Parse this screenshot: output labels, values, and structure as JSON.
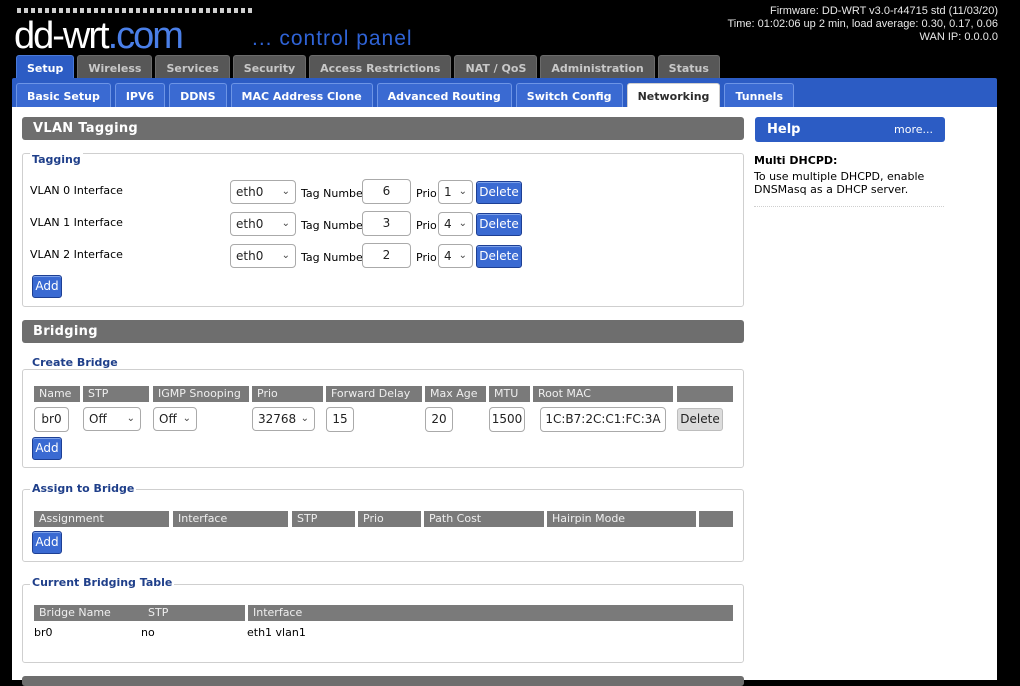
{
  "header": {
    "logo_main": "dd-wrt",
    "logo_suffix": ".com",
    "subtitle": "... control panel",
    "firmware": "Firmware: DD-WRT v3.0-r44715 std (11/03/20)",
    "time": "Time: 01:02:06 up 2 min, load average: 0.30, 0.17, 0.06",
    "wan_ip": "WAN IP: 0.0.0.0"
  },
  "main_tabs": [
    "Setup",
    "Wireless",
    "Services",
    "Security",
    "Access Restrictions",
    "NAT / QoS",
    "Administration",
    "Status"
  ],
  "sub_tabs": [
    "Basic Setup",
    "IPV6",
    "DDNS",
    "MAC Address Clone",
    "Advanced Routing",
    "Switch Config",
    "Networking",
    "Tunnels"
  ],
  "vlan": {
    "section_title": "VLAN Tagging",
    "legend": "Tagging",
    "tag_label": "Tag Number",
    "prio_label": "Prio",
    "delete_label": "Delete",
    "add_label": "Add",
    "rows": [
      {
        "label": "VLAN 0 Interface",
        "iface": "eth0",
        "tag": "6",
        "prio": "1"
      },
      {
        "label": "VLAN 1 Interface",
        "iface": "eth0",
        "tag": "3",
        "prio": "4"
      },
      {
        "label": "VLAN 2 Interface",
        "iface": "eth0",
        "tag": "2",
        "prio": "4"
      }
    ]
  },
  "bridging": {
    "section_title": "Bridging",
    "create": {
      "legend": "Create Bridge",
      "headers": [
        "Name",
        "STP",
        "IGMP Snooping",
        "Prio",
        "Forward Delay",
        "Max Age",
        "MTU",
        "Root MAC",
        ""
      ],
      "row": {
        "name": "br0",
        "stp": "Off",
        "igmp": "Off",
        "prio": "32768",
        "forward_delay": "15",
        "max_age": "20",
        "mtu": "1500",
        "root_mac": "1C:B7:2C:C1:FC:3A",
        "delete": "Delete"
      },
      "add_label": "Add"
    },
    "assign": {
      "legend": "Assign to Bridge",
      "headers": [
        "Assignment",
        "Interface",
        "STP",
        "Prio",
        "Path Cost",
        "Hairpin Mode",
        ""
      ],
      "add_label": "Add"
    },
    "current": {
      "legend": "Current Bridging Table",
      "headers": [
        "Bridge Name",
        "STP",
        "Interface"
      ],
      "rows": [
        {
          "bridge": "br0",
          "stp": "no",
          "iface": "eth1 vlan1"
        }
      ]
    }
  },
  "help": {
    "title": "Help",
    "more": "more...",
    "heading": "Multi DHCPD:",
    "text": "To use multiple DHCPD, enable DNSMasq as a DHCP server."
  },
  "colors": {
    "accent": "#2c5cc4",
    "section": "#6e6e6e",
    "legend": "#1f3f8a"
  }
}
